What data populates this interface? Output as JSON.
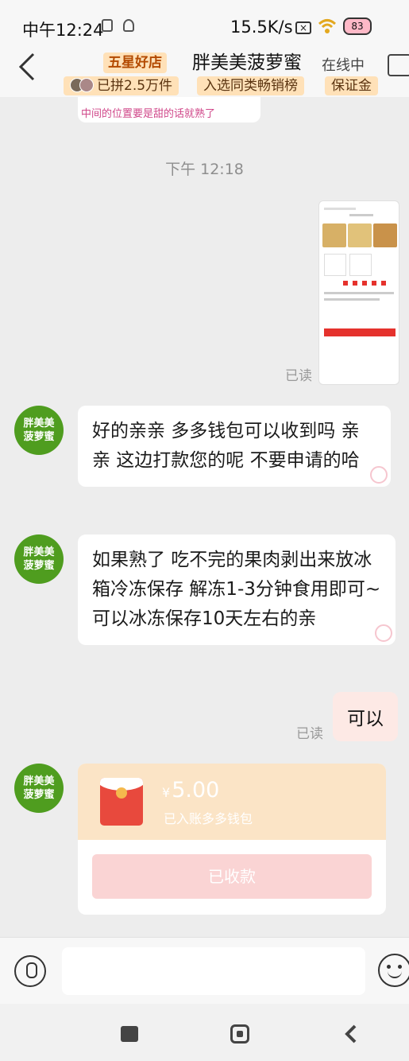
{
  "status": {
    "time": "中午12:24",
    "network_speed": "15.5K/s",
    "battery": "83"
  },
  "header": {
    "store_badge": "五星好店",
    "shop_name": "胖美美菠萝蜜",
    "presence": "在线中",
    "tags": [
      "已拼2.5万件",
      "入选同类畅销榜",
      "保证金"
    ]
  },
  "chat": {
    "previous_snippet": "中间的位置要是甜的话就熟了",
    "time_separator": "下午 12:18",
    "read_label": "已读",
    "seller_avatar_text": "胖美美菠萝蜜",
    "messages": [
      "好的亲亲 多多钱包可以收到吗 亲亲 这边打款您的呢 不要申请的哈",
      "如果熟了 吃不完的果肉剥出来放冰箱冷冻保存 解冻1-3分钟食用即可~ 可以冰冻保存10天左右的亲"
    ],
    "my_message": "可以",
    "red_packet": {
      "currency": "¥",
      "amount": "5.00",
      "subtitle": "已入账多多钱包",
      "button_label": "已收款"
    }
  },
  "input": {
    "placeholder": ""
  },
  "colors": {
    "seller_avatar": "#4f9d1f",
    "red_packet_header": "#fbe4c6",
    "my_bubble": "#fde9e5",
    "badge_bg": "#ffe1b8"
  }
}
